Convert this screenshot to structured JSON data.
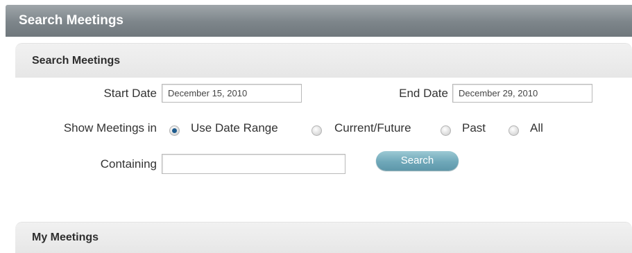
{
  "page_title": "Search Meetings",
  "search_panel": {
    "title": "Search Meetings",
    "start_date_label": "Start Date",
    "start_date_value": "December 15, 2010",
    "end_date_label": "End Date",
    "end_date_value": "December 29, 2010",
    "show_label": "Show Meetings in",
    "options": [
      {
        "label": "Use Date Range",
        "checked": true
      },
      {
        "label": "Current/Future",
        "checked": false
      },
      {
        "label": "Past",
        "checked": false
      },
      {
        "label": "All",
        "checked": false
      }
    ],
    "containing_label": "Containing",
    "containing_value": "",
    "search_button": "Search"
  },
  "my_meetings_panel": {
    "title": "My Meetings"
  }
}
